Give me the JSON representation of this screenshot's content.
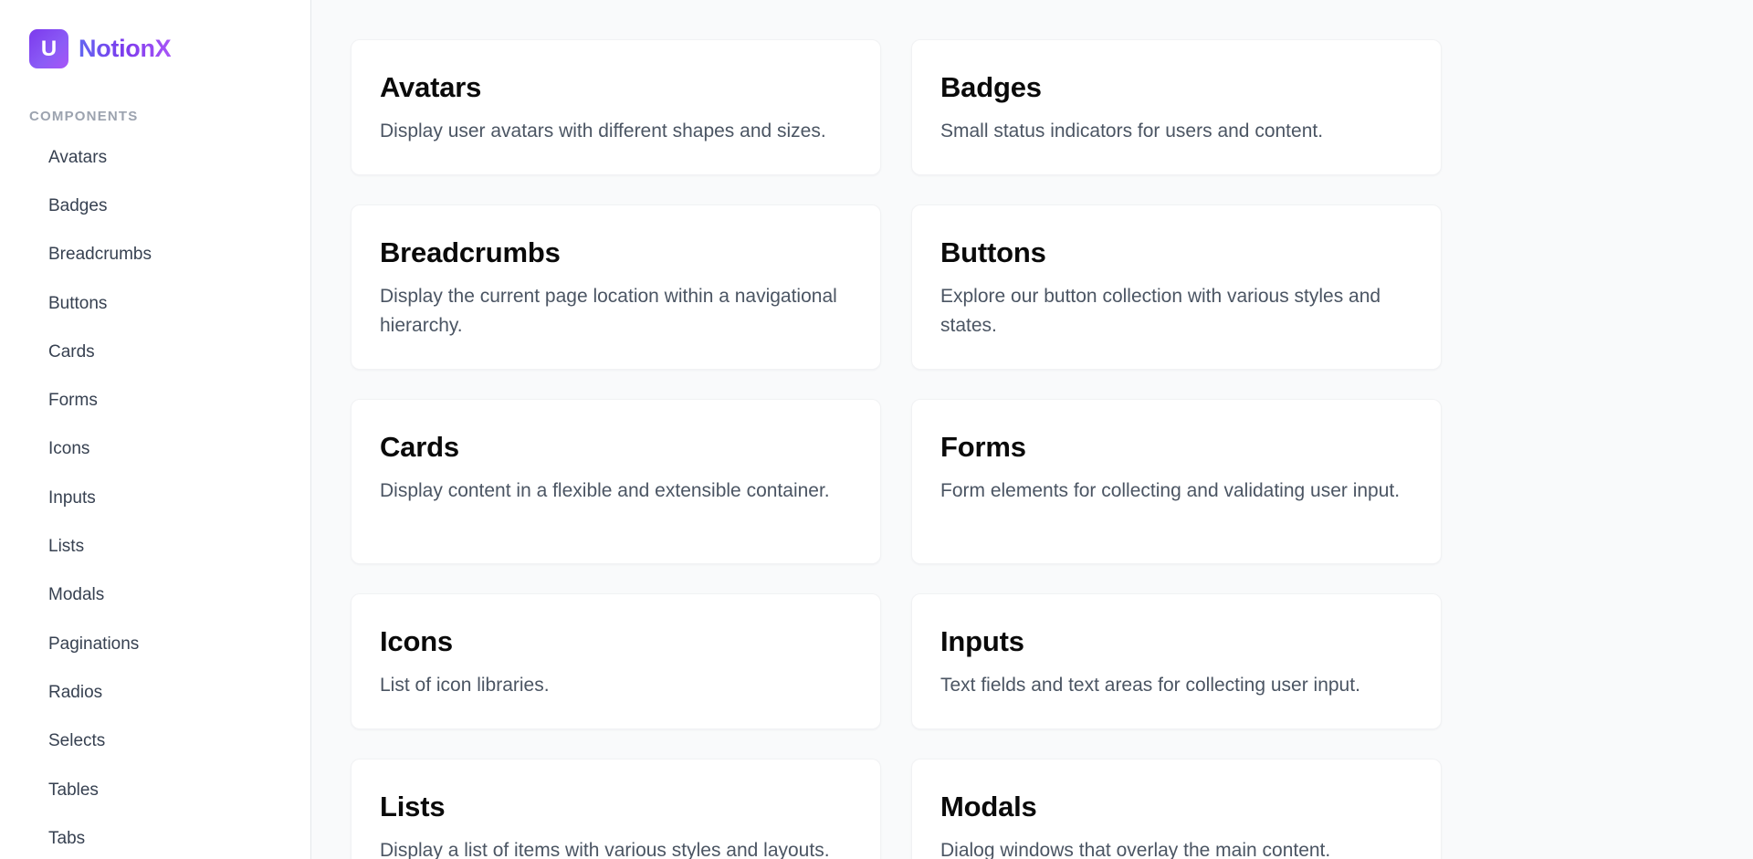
{
  "brand": {
    "logo_letter": "U",
    "name": "NotionX"
  },
  "sidebar": {
    "section_label": "COMPONENTS",
    "items": [
      {
        "label": "Avatars"
      },
      {
        "label": "Badges"
      },
      {
        "label": "Breadcrumbs"
      },
      {
        "label": "Buttons"
      },
      {
        "label": "Cards"
      },
      {
        "label": "Forms"
      },
      {
        "label": "Icons"
      },
      {
        "label": "Inputs"
      },
      {
        "label": "Lists"
      },
      {
        "label": "Modals"
      },
      {
        "label": "Paginations"
      },
      {
        "label": "Radios"
      },
      {
        "label": "Selects"
      },
      {
        "label": "Tables"
      },
      {
        "label": "Tabs"
      }
    ]
  },
  "cards": [
    {
      "title": "Avatars",
      "description": "Display user avatars with different shapes and sizes."
    },
    {
      "title": "Badges",
      "description": "Small status indicators for users and content."
    },
    {
      "title": "Breadcrumbs",
      "description": "Display the current page location within a navigational hierarchy."
    },
    {
      "title": "Buttons",
      "description": "Explore our button collection with various styles and states."
    },
    {
      "title": "Cards",
      "description": "Display content in a flexible and extensible container."
    },
    {
      "title": "Forms",
      "description": "Form elements for collecting and validating user input."
    },
    {
      "title": "Icons",
      "description": "List of icon libraries."
    },
    {
      "title": "Inputs",
      "description": "Text fields and text areas for collecting user input."
    },
    {
      "title": "Lists",
      "description": "Display a list of items with various styles and layouts."
    },
    {
      "title": "Modals",
      "description": "Dialog windows that overlay the main content."
    }
  ],
  "colors": {
    "accent": "#7c3aed",
    "background": "#f9fafb",
    "card": "#ffffff",
    "muted_text": "#4b5563",
    "section_label": "#9ca3af"
  }
}
